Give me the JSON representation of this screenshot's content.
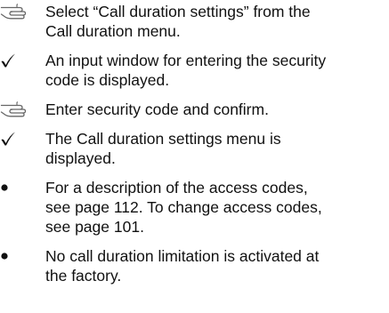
{
  "instructions": [
    {
      "marker": "pointing-hand-icon",
      "lines": [
        "Select “Call duration settings” from the",
        "Call duration menu."
      ]
    },
    {
      "marker": "checkmark-icon",
      "lines": [
        "An input window for entering the security",
        "code is displayed."
      ]
    },
    {
      "marker": "pointing-hand-icon",
      "lines": [
        "Enter security code and confirm."
      ]
    },
    {
      "marker": "checkmark-icon",
      "lines": [
        "The Call duration settings menu is",
        "displayed."
      ]
    },
    {
      "marker": "bullet-icon",
      "lines": [
        "For a description of the access codes,",
        "see page 112. To change access codes,",
        "see page 101."
      ]
    },
    {
      "marker": "bullet-icon",
      "lines": [
        "No call duration limitation is activated at",
        "the factory."
      ]
    }
  ]
}
